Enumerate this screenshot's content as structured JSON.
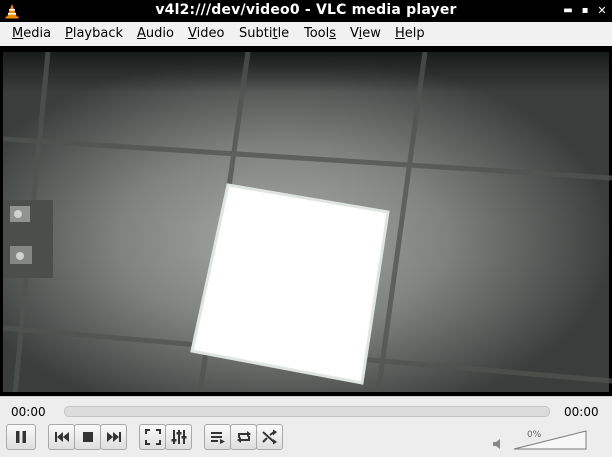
{
  "window": {
    "title": "v4l2:///dev/video0 - VLC media player"
  },
  "menubar": {
    "items": [
      {
        "label": "Media",
        "accel": "M"
      },
      {
        "label": "Playback",
        "accel": "P"
      },
      {
        "label": "Audio",
        "accel": "A"
      },
      {
        "label": "Video",
        "accel": "V"
      },
      {
        "label": "Subtitle",
        "accel": "t"
      },
      {
        "label": "Tools",
        "accel": "s"
      },
      {
        "label": "View",
        "accel": "i"
      },
      {
        "label": "Help",
        "accel": "H"
      }
    ]
  },
  "playback": {
    "elapsed": "00:00",
    "remaining": "00:00",
    "progress": 0
  },
  "volume": {
    "percent_label": "0%",
    "level": 0
  },
  "controls": {
    "buttons": [
      "pause-icon",
      "previous-icon",
      "stop-icon",
      "next-icon",
      "fullscreen-icon",
      "extended-settings-icon",
      "playlist-icon",
      "loop-icon",
      "shuffle-icon"
    ]
  },
  "colors": {
    "titlebar": "#000000",
    "menubar": "#f1f1f1",
    "controls": "#ededed",
    "vlc_orange": "#f08a00"
  }
}
